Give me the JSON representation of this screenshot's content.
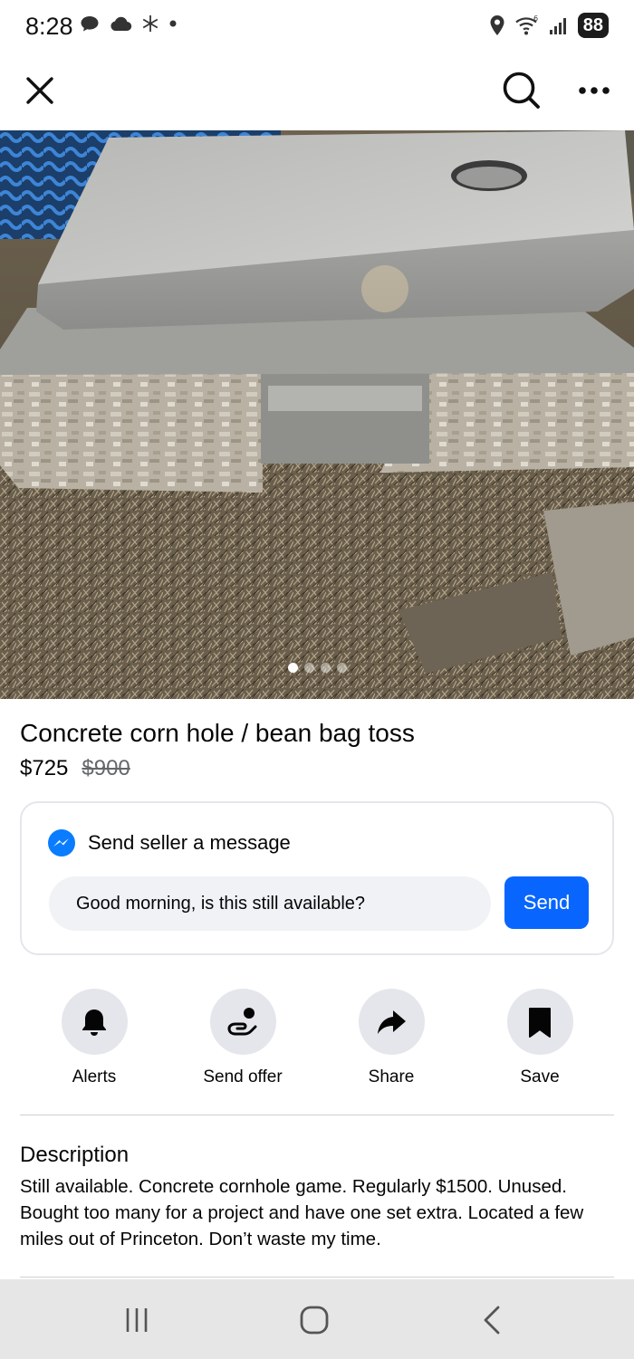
{
  "status_bar": {
    "time": "8:28",
    "battery": "88"
  },
  "listing": {
    "title": "Concrete corn hole / bean bag toss",
    "price": "$725",
    "original_price": "$900",
    "photo_count": 4,
    "active_photo": 1
  },
  "message_card": {
    "header": "Send seller a message",
    "input_value": "Good morning, is this still available?",
    "send_label": "Send"
  },
  "actions": [
    {
      "label": "Alerts",
      "icon": "bell-icon"
    },
    {
      "label": "Send offer",
      "icon": "offer-hand-icon"
    },
    {
      "label": "Share",
      "icon": "share-arrow-icon"
    },
    {
      "label": "Save",
      "icon": "bookmark-icon"
    }
  ],
  "description": {
    "title": "Description",
    "body": "Still available. Concrete cornhole game.  Regularly $1500.  Unused.  Bought too many for a project and have one set extra.  Located a few miles out of Princeton.  Don’t waste my time."
  },
  "colors": {
    "accent": "#0866ff",
    "circle_bg": "#e4e6eb",
    "input_bg": "#f0f2f5",
    "text": "#050505",
    "muted": "#65676b"
  }
}
